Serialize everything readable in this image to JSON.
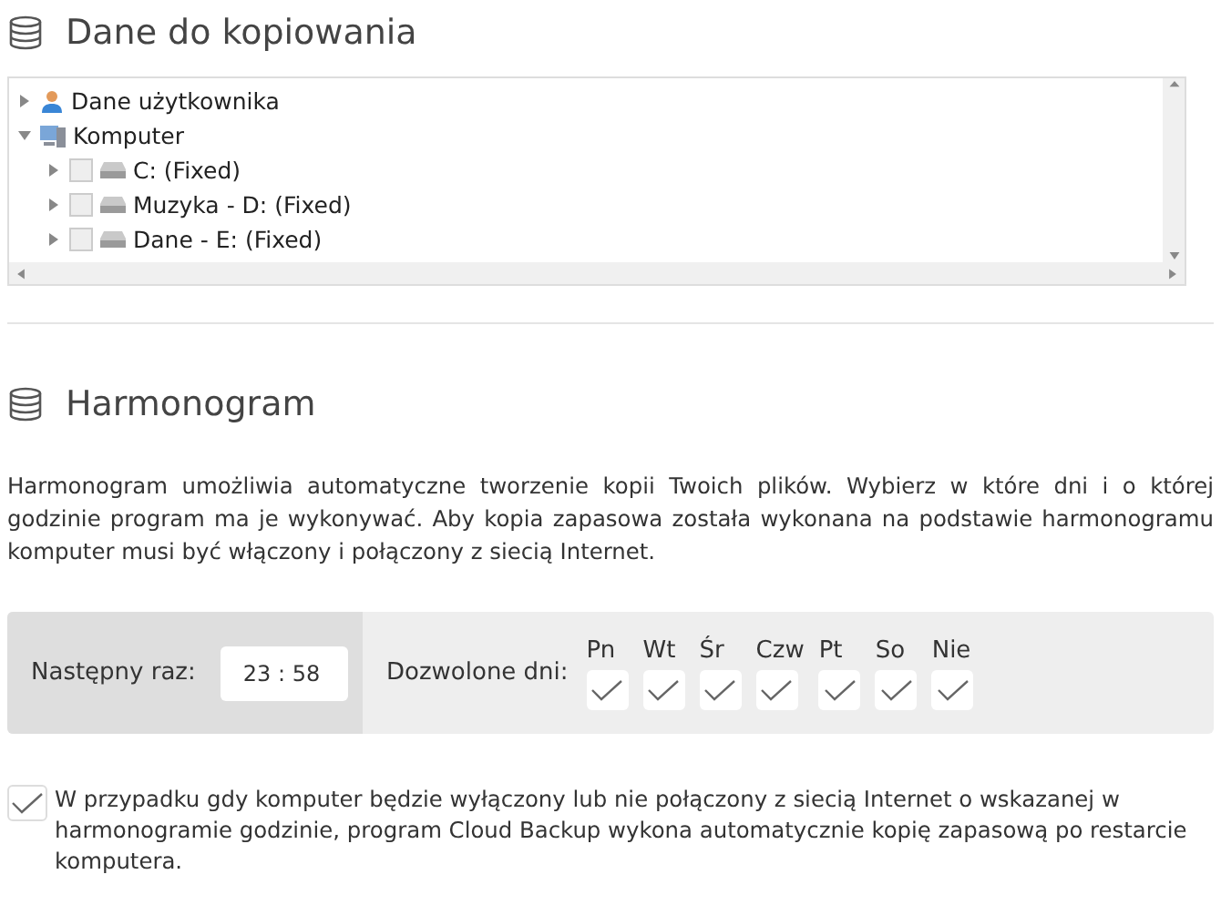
{
  "sections": [
    {
      "title": "Dane do kopiowania"
    },
    {
      "title": "Harmonogram"
    }
  ],
  "tree": [
    {
      "label": "Dane użytkownika",
      "kind": "user",
      "expanded": false
    },
    {
      "label": "Komputer",
      "kind": "computer",
      "expanded": true,
      "children": [
        {
          "label": "C: (Fixed)",
          "kind": "drive",
          "expanded": false,
          "checked": false
        },
        {
          "label": "Muzyka - D: (Fixed)",
          "kind": "drive",
          "expanded": false,
          "checked": false
        },
        {
          "label": "Dane - E: (Fixed)",
          "kind": "drive",
          "expanded": false,
          "checked": false
        }
      ]
    }
  ],
  "description": "Harmonogram umożliwia automatyczne tworzenie kopii Twoich plików. Wybierz w które dni i o której godzinie program ma je wykonywać. Aby kopia zapasowa została wykonana na podstawie harmonogramu komputer musi być włączony i połączony z siecią Internet.",
  "next_run": {
    "label": "Następny raz:",
    "value": "23 : 58"
  },
  "days": {
    "label": "Dozwolone dni:",
    "items": [
      {
        "label": "Pn",
        "checked": true
      },
      {
        "label": "Wt",
        "checked": true
      },
      {
        "label": "Śr",
        "checked": true
      },
      {
        "label": "Czw",
        "checked": true
      },
      {
        "label": "Pt",
        "checked": true
      },
      {
        "label": "So",
        "checked": true
      },
      {
        "label": "Nie",
        "checked": true
      }
    ]
  },
  "catch_up": {
    "checked": true,
    "text": "W przypadku gdy komputer będzie wyłączony lub nie połączony z siecią Internet o wskazanej w harmonogramie godzinie, program Cloud Backup wykona automatycznie kopię zapasową po restarcie komputera."
  }
}
